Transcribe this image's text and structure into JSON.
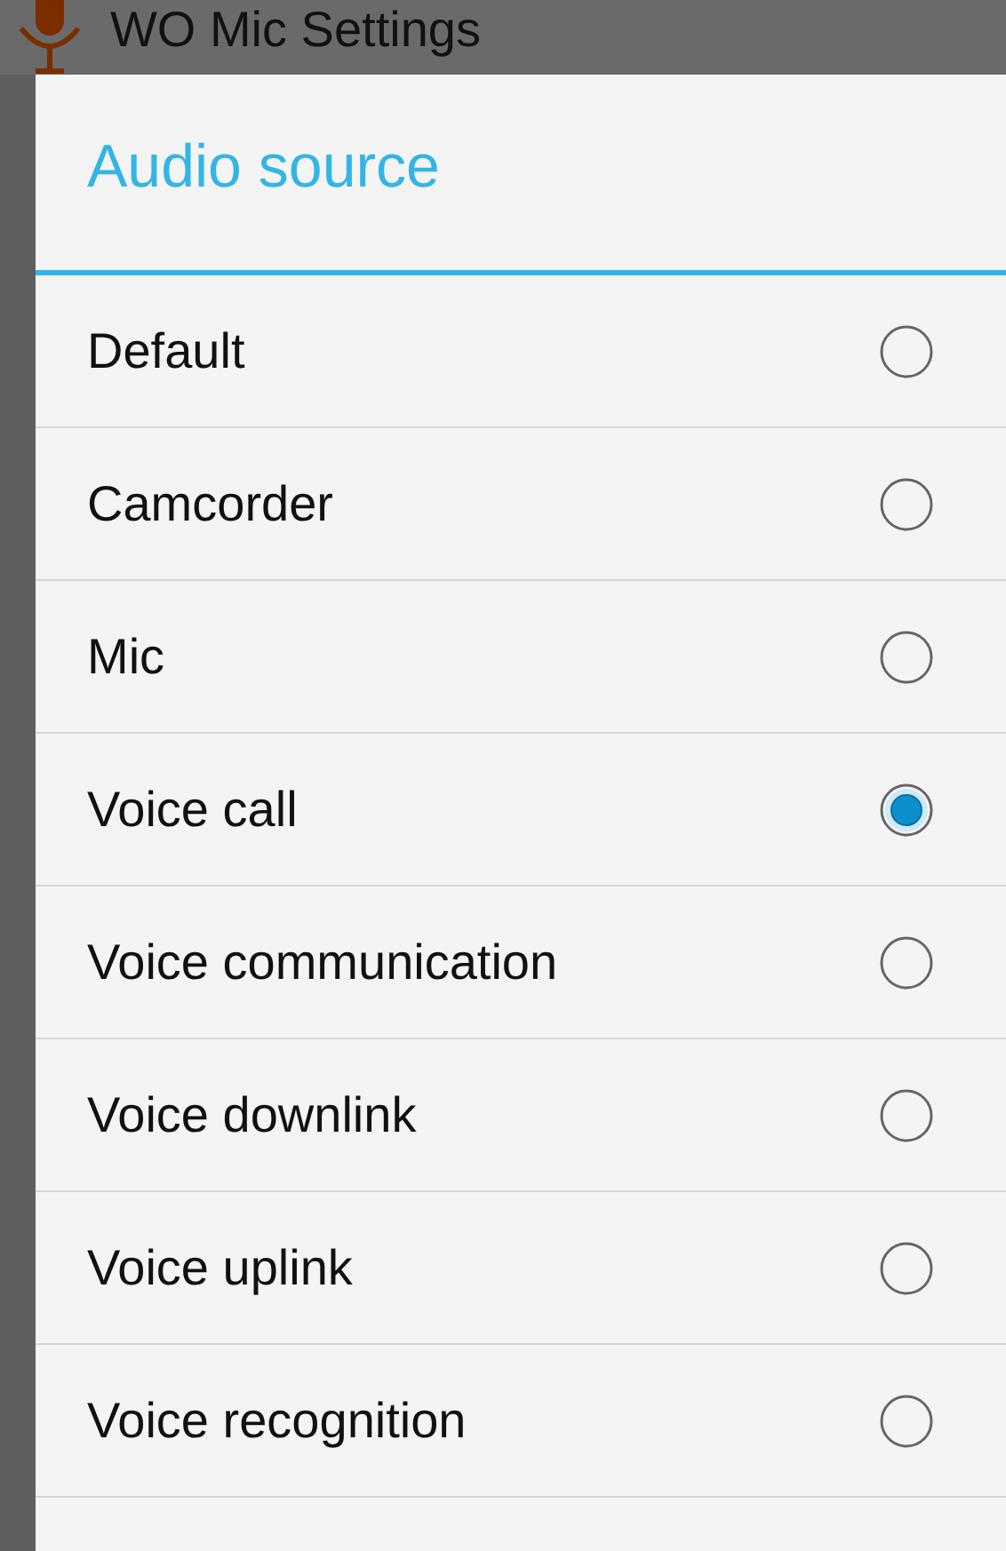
{
  "app_bar": {
    "title": "WO Mic Settings"
  },
  "dialog": {
    "title": "Audio source",
    "options": [
      {
        "label": "Default",
        "selected": false
      },
      {
        "label": "Camcorder",
        "selected": false
      },
      {
        "label": "Mic",
        "selected": false
      },
      {
        "label": "Voice call",
        "selected": true
      },
      {
        "label": "Voice communication",
        "selected": false
      },
      {
        "label": "Voice downlink",
        "selected": false
      },
      {
        "label": "Voice uplink",
        "selected": false
      },
      {
        "label": "Voice recognition",
        "selected": false
      }
    ]
  }
}
